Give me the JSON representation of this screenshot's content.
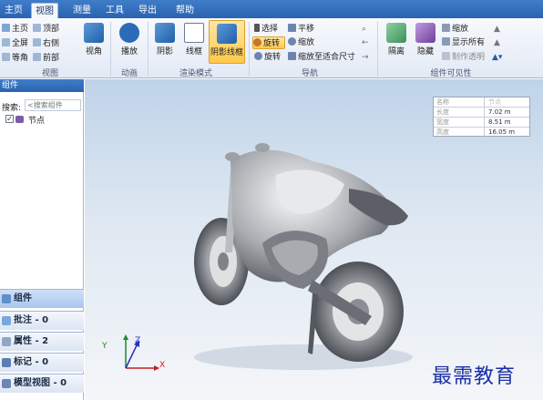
{
  "tabs": [
    {
      "label": "主页",
      "active": false
    },
    {
      "label": "视图",
      "active": true
    },
    {
      "label": "测量",
      "active": false
    },
    {
      "label": "工具",
      "active": false
    },
    {
      "label": "导出",
      "active": false
    },
    {
      "label": "帮助",
      "active": false
    }
  ],
  "ribbon": {
    "view_group": {
      "label": "视图",
      "items": [
        "主页",
        "顶部",
        "全屏",
        "右侧",
        "等角",
        "前部"
      ],
      "big": "视角"
    },
    "anim_group": {
      "label": "动画",
      "play": "播放"
    },
    "render_group": {
      "label": "渲染模式",
      "shaded": "阴影",
      "wireframe": "线框",
      "shaded_wire": "阴影线框"
    },
    "nav_group": {
      "label": "导航",
      "select": "选择",
      "pan": "平移",
      "rotate_active": "旋转",
      "zoom": "缩放",
      "rotate": "旋转",
      "fit": "缩放至适合尺寸"
    },
    "visibility_group": {
      "label": "组件可见性",
      "isolate": "隔离",
      "hide": "隐藏",
      "zoom": "缩放",
      "show_all": "显示所有",
      "make_transparent": "制作透明"
    }
  },
  "panel": {
    "header": "组件",
    "search_label": "搜索:",
    "search_placeholder": "<搜索组件",
    "tree_node": "节点",
    "stack": [
      {
        "label": "组件",
        "active": true
      },
      {
        "label": "批注 - 0",
        "active": false
      },
      {
        "label": "属性 - 2",
        "active": false
      },
      {
        "label": "标记 - 0",
        "active": false
      },
      {
        "label": "模型视图 - 0",
        "active": false
      }
    ]
  },
  "info_table": {
    "rows": [
      {
        "key": "名称",
        "value": "节点"
      },
      {
        "key": "长度",
        "value": "7.02 m"
      },
      {
        "key": "宽度",
        "value": "8.51 m"
      },
      {
        "key": "高度",
        "value": "16.05 m"
      }
    ]
  },
  "triad": {
    "x": "X",
    "y": "Y",
    "z": "Z"
  },
  "watermark": "最需教育",
  "colors": {
    "accent": "#2a63b0",
    "active": "#ffc84a",
    "viewport_top": "#bfd3e8"
  }
}
